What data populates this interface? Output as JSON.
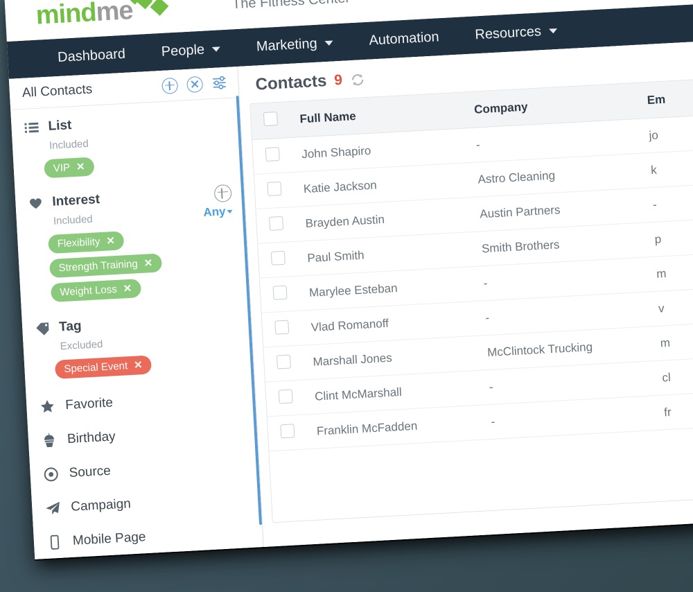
{
  "brand": {
    "logo_mind": "mind",
    "logo_me": "me",
    "account_name": "The Fitness Center"
  },
  "nav": {
    "items": [
      {
        "label": "Dashboard",
        "has_caret": false
      },
      {
        "label": "People",
        "has_caret": true
      },
      {
        "label": "Marketing",
        "has_caret": true
      },
      {
        "label": "Automation",
        "has_caret": false
      },
      {
        "label": "Resources",
        "has_caret": true
      }
    ]
  },
  "sidebar": {
    "title": "All Contacts",
    "header_icons": [
      "plus-circle-icon",
      "x-circle-icon",
      "filter-sliders-icon"
    ],
    "groups": [
      {
        "icon": "list-icon",
        "label": "List",
        "mode_label": "Included",
        "pills": [
          {
            "label": "VIP",
            "color": "#8bc97c"
          }
        ],
        "has_add": false,
        "any_label": null
      },
      {
        "icon": "heart-icon",
        "label": "Interest",
        "mode_label": "Included",
        "pills": [
          {
            "label": "Flexibility",
            "color": "#8bc97c"
          },
          {
            "label": "Strength Training",
            "color": "#8bc97c"
          },
          {
            "label": "Weight Loss",
            "color": "#8bc97c"
          }
        ],
        "has_add": true,
        "any_label": "Any"
      },
      {
        "icon": "tag-icon",
        "label": "Tag",
        "mode_label": "Excluded",
        "pills": [
          {
            "label": "Special Event",
            "color": "#ea6b5a"
          }
        ],
        "has_add": false,
        "any_label": null
      }
    ],
    "items": [
      {
        "icon": "star-icon",
        "label": "Favorite"
      },
      {
        "icon": "cupcake-icon",
        "label": "Birthday"
      },
      {
        "icon": "target-icon",
        "label": "Source"
      },
      {
        "icon": "paper-plane-icon",
        "label": "Campaign"
      },
      {
        "icon": "mobile-phone-icon",
        "label": "Mobile Page"
      }
    ],
    "pill_remove_glyph": "✕"
  },
  "content": {
    "title": "Contacts",
    "count": "9",
    "refresh_icon": "refresh-icon",
    "table": {
      "columns": [
        "Full Name",
        "Company",
        "Em"
      ],
      "rows": [
        {
          "name": "John Shapiro",
          "company": "-",
          "email": "jo"
        },
        {
          "name": "Katie Jackson",
          "company": "Astro Cleaning",
          "email": "k"
        },
        {
          "name": "Brayden Austin",
          "company": "Austin Partners",
          "email": "-"
        },
        {
          "name": "Paul Smith",
          "company": "Smith Brothers",
          "email": "p"
        },
        {
          "name": "Marylee Esteban",
          "company": "-",
          "email": "m"
        },
        {
          "name": "Vlad Romanoff",
          "company": "-",
          "email": "v"
        },
        {
          "name": "Marshall Jones",
          "company": "McClintock Trucking",
          "email": "m"
        },
        {
          "name": "Clint McMarshall",
          "company": "-",
          "email": "cl"
        },
        {
          "name": "Franklin McFadden",
          "company": "-",
          "email": "fr"
        }
      ]
    }
  },
  "colors": {
    "nav_bg": "#1f3040",
    "brand_green": "#72bf44",
    "brand_gray": "#9b9b9b",
    "accent_blue": "#5b9bd5",
    "pill_green": "#8bc97c",
    "pill_red": "#ea6b5a",
    "count_red": "#e8503a",
    "page_bg": "#3f5560"
  }
}
